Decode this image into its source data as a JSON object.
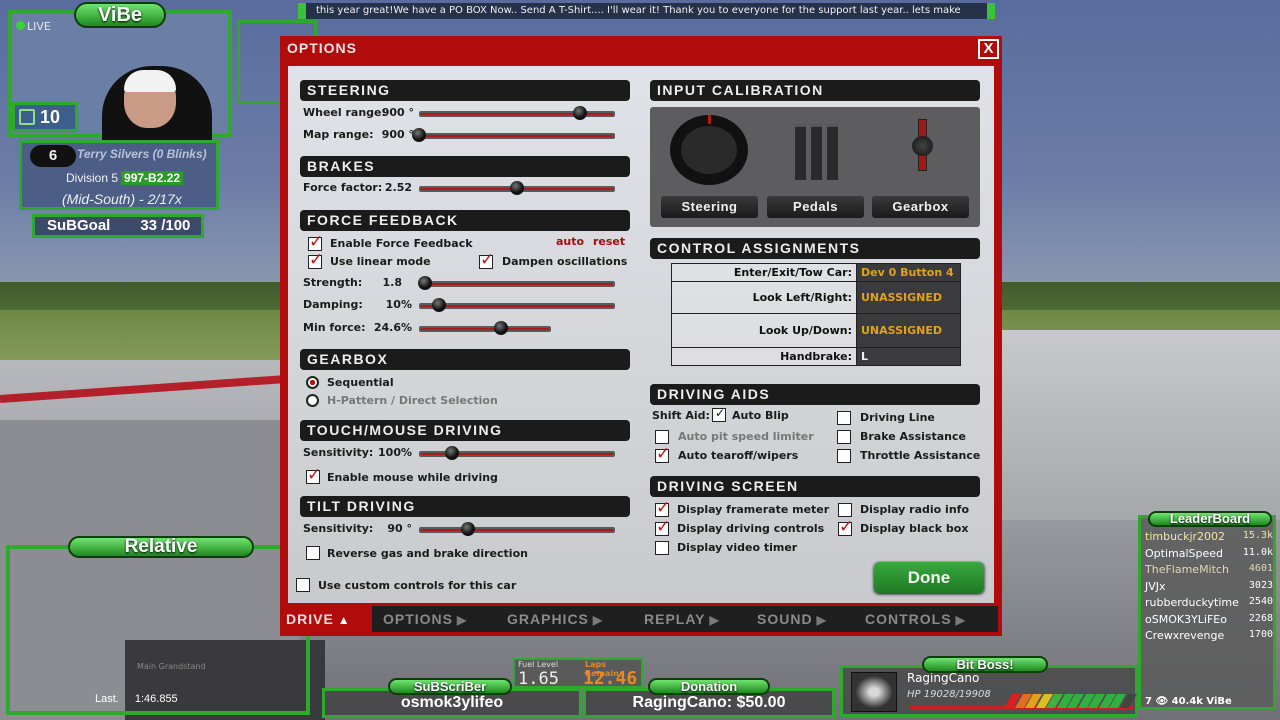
{
  "stream_overlay": {
    "ticker_text": "this year great!We have a PO BOX Now.. Send A T-Shirt.... I'll wear it!  Thank you to everyone for the support last year.. lets make",
    "brand_badge": "ViBe",
    "live_label": "LIVE",
    "viewer_count": "10",
    "driver_card": {
      "position": "6",
      "name": "Terry Silvers (0 Blinks)",
      "division": "Division 5",
      "license": "997-B2.22",
      "region": "(Mid-South) - 2/17x"
    },
    "sub_goal": {
      "label": "SuBGoal",
      "value": "33 /100"
    },
    "relative": {
      "title": "Relative",
      "last_label": "Last.",
      "last_time": "1:46.855",
      "track_sign": "Main Grandstand"
    },
    "fuel": {
      "fuel_label": "Fuel Level",
      "fuel_value": "1.65",
      "laps_label": "Laps Remain",
      "laps_value": "12.46"
    },
    "subscriber": {
      "title": "SuBScriBer",
      "name": "osmok3ylifeo"
    },
    "donation": {
      "title": "Donation",
      "text": "RagingCano: $50.00"
    },
    "bit_boss": {
      "title": "Bit Boss!",
      "name": "RagingCano",
      "hp_text": "HP 19028/19908",
      "hp_fraction": 0.956
    },
    "leaderboard": {
      "title": "LeaderBoard",
      "rows": [
        {
          "name": "timbuckjr2002",
          "score": "15.3k"
        },
        {
          "name": "OptimalSpeed",
          "score": "11.0k"
        },
        {
          "name": "TheFlameMitch",
          "score": "4601"
        },
        {
          "name": "JVJx",
          "score": "3023"
        },
        {
          "name": "rubberduckytime",
          "score": "2540"
        },
        {
          "name": "oSMOK3YLiFEo",
          "score": "2268"
        },
        {
          "name": "Crewxrevenge",
          "score": "1700"
        }
      ],
      "footer": "7 👁 40.4k ViBe"
    }
  },
  "dialog": {
    "title": "OPTIONS",
    "close_label": "X",
    "steering": {
      "header": "STEERING",
      "wheel_range_label": "Wheel range:",
      "wheel_range_value": "900 °",
      "wheel_range_pos": 0.82,
      "map_range_label": "Map range:",
      "map_range_value": "900 °",
      "map_range_pos": 0.0
    },
    "brakes": {
      "header": "BRAKES",
      "force_factor_label": "Force factor:",
      "force_factor_value": "2.52",
      "force_factor_pos": 0.5
    },
    "force_feedback": {
      "header": "FORCE FEEDBACK",
      "enable_label": "Enable Force Feedback",
      "enable_checked": true,
      "auto_label": "auto",
      "reset_label": "reset",
      "linear_label": "Use linear mode",
      "linear_checked": true,
      "dampen_label": "Dampen oscillations",
      "dampen_checked": true,
      "strength_label": "Strength:",
      "strength_value": "1.8",
      "strength_pos": 0.03,
      "damping_label": "Damping:",
      "damping_value": "10%",
      "damping_pos": 0.1,
      "minforce_label": "Min force:",
      "minforce_value": "24.6%",
      "minforce_pos": 0.62
    },
    "gearbox": {
      "header": "GEARBOX",
      "options": [
        {
          "label": "Sequential",
          "selected": true
        },
        {
          "label": "H-Pattern / Direct Selection",
          "selected": false
        }
      ]
    },
    "touch_mouse": {
      "header": "TOUCH/MOUSE DRIVING",
      "sensitivity_label": "Sensitivity:",
      "sensitivity_value": "100%",
      "sensitivity_pos": 0.17,
      "enable_mouse_label": "Enable mouse while driving",
      "enable_mouse_checked": true
    },
    "tilt": {
      "header": "TILT DRIVING",
      "sensitivity_label": "Sensitivity:",
      "sensitivity_value": "90 °",
      "sensitivity_pos": 0.25,
      "reverse_label": "Reverse gas and brake direction",
      "reverse_checked": false
    },
    "custom_controls_label": "Use custom controls for this car",
    "custom_controls_checked": false,
    "input_calibration": {
      "header": "INPUT CALIBRATION",
      "buttons": [
        "Steering",
        "Pedals",
        "Gearbox"
      ]
    },
    "control_assignments": {
      "header": "CONTROL ASSIGNMENTS",
      "rows": [
        {
          "action": "Enter/Exit/Tow Car:",
          "binding": "Dev 0 Button 4"
        },
        {
          "action": "Look Left/Right:",
          "binding": "UNASSIGNED"
        },
        {
          "action": "Look Up/Down:",
          "binding": "UNASSIGNED"
        },
        {
          "action": "Handbrake:",
          "binding": "L"
        }
      ]
    },
    "driving_aids": {
      "header": "DRIVING AIDS",
      "shift_aid_label": "Shift Aid:",
      "auto_blip_label": "Auto Blip",
      "auto_blip_checked": true,
      "auto_pit_label": "Auto pit speed limiter",
      "auto_pit_checked": false,
      "auto_tearoff_label": "Auto tearoff/wipers",
      "auto_tearoff_checked": true,
      "driving_line_label": "Driving Line",
      "driving_line_checked": false,
      "brake_assist_label": "Brake Assistance",
      "brake_assist_checked": false,
      "throttle_assist_label": "Throttle Assistance",
      "throttle_assist_checked": false
    },
    "driving_screen": {
      "header": "DRIVING SCREEN",
      "framerate_label": "Display framerate meter",
      "framerate_checked": true,
      "controls_label": "Display driving controls",
      "controls_checked": true,
      "video_timer_label": "Display video timer",
      "video_timer_checked": false,
      "radio_label": "Display radio info",
      "radio_checked": false,
      "blackbox_label": "Display black box",
      "blackbox_checked": true
    },
    "done_label": "Done"
  },
  "bottom_tabs": [
    {
      "label": "DRIVE",
      "active": true
    },
    {
      "label": "OPTIONS",
      "active": false
    },
    {
      "label": "GRAPHICS",
      "active": false
    },
    {
      "label": "REPLAY",
      "active": false
    },
    {
      "label": "SOUND",
      "active": false
    },
    {
      "label": "CONTROLS",
      "active": false
    }
  ]
}
